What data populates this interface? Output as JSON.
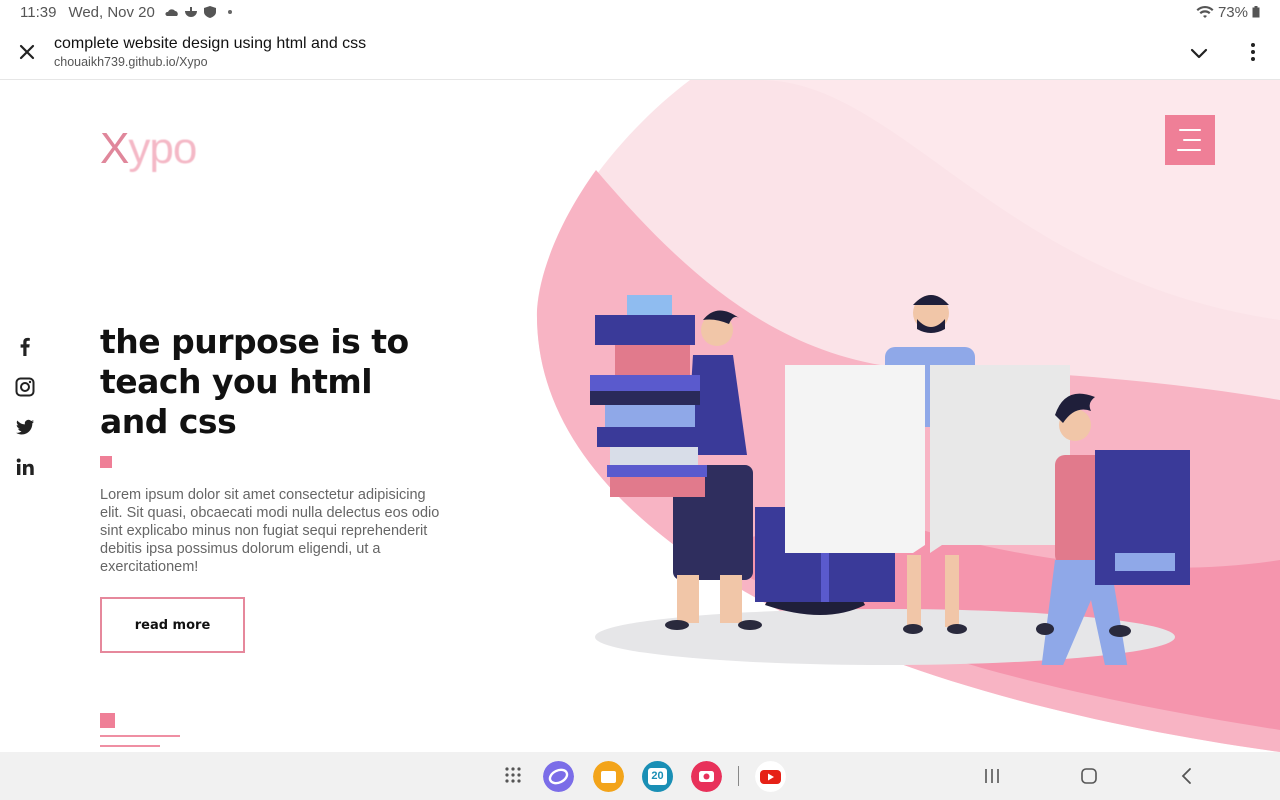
{
  "status_bar": {
    "time": "11:39",
    "date": "Wed, Nov 20",
    "battery": "73%"
  },
  "browser": {
    "title": "complete website design using html and css",
    "url": "chouaikh739.github.io/Xypo"
  },
  "site": {
    "logo_x": "X",
    "logo_rest": "ypo",
    "headline": "the purpose is to teach you html and css",
    "paragraph": "Lorem ipsum dolor sit amet consectetur adipisicing elit. Sit quasi, obcaecati modi nulla delectus eos odio sint explicabo minus non fugiat sequi reprehenderit debitis ipsa possimus dolorum eligendi, ut a exercitationem!",
    "button": "read more",
    "socials": [
      "facebook-icon",
      "instagram-icon",
      "twitter-icon",
      "linkedin-icon"
    ]
  },
  "colors": {
    "accent": "#ef7f97",
    "pink_light": "#fbe3e8",
    "pink_mid": "#f8b4c4",
    "pink_dark": "#f595ad"
  },
  "taskbar": {
    "apps": [
      "apps-grid-icon",
      "samsung-internet-icon",
      "my-files-icon",
      "calendar-icon",
      "screen-recorder-icon",
      "youtube-icon"
    ],
    "calendar_day": "20"
  }
}
